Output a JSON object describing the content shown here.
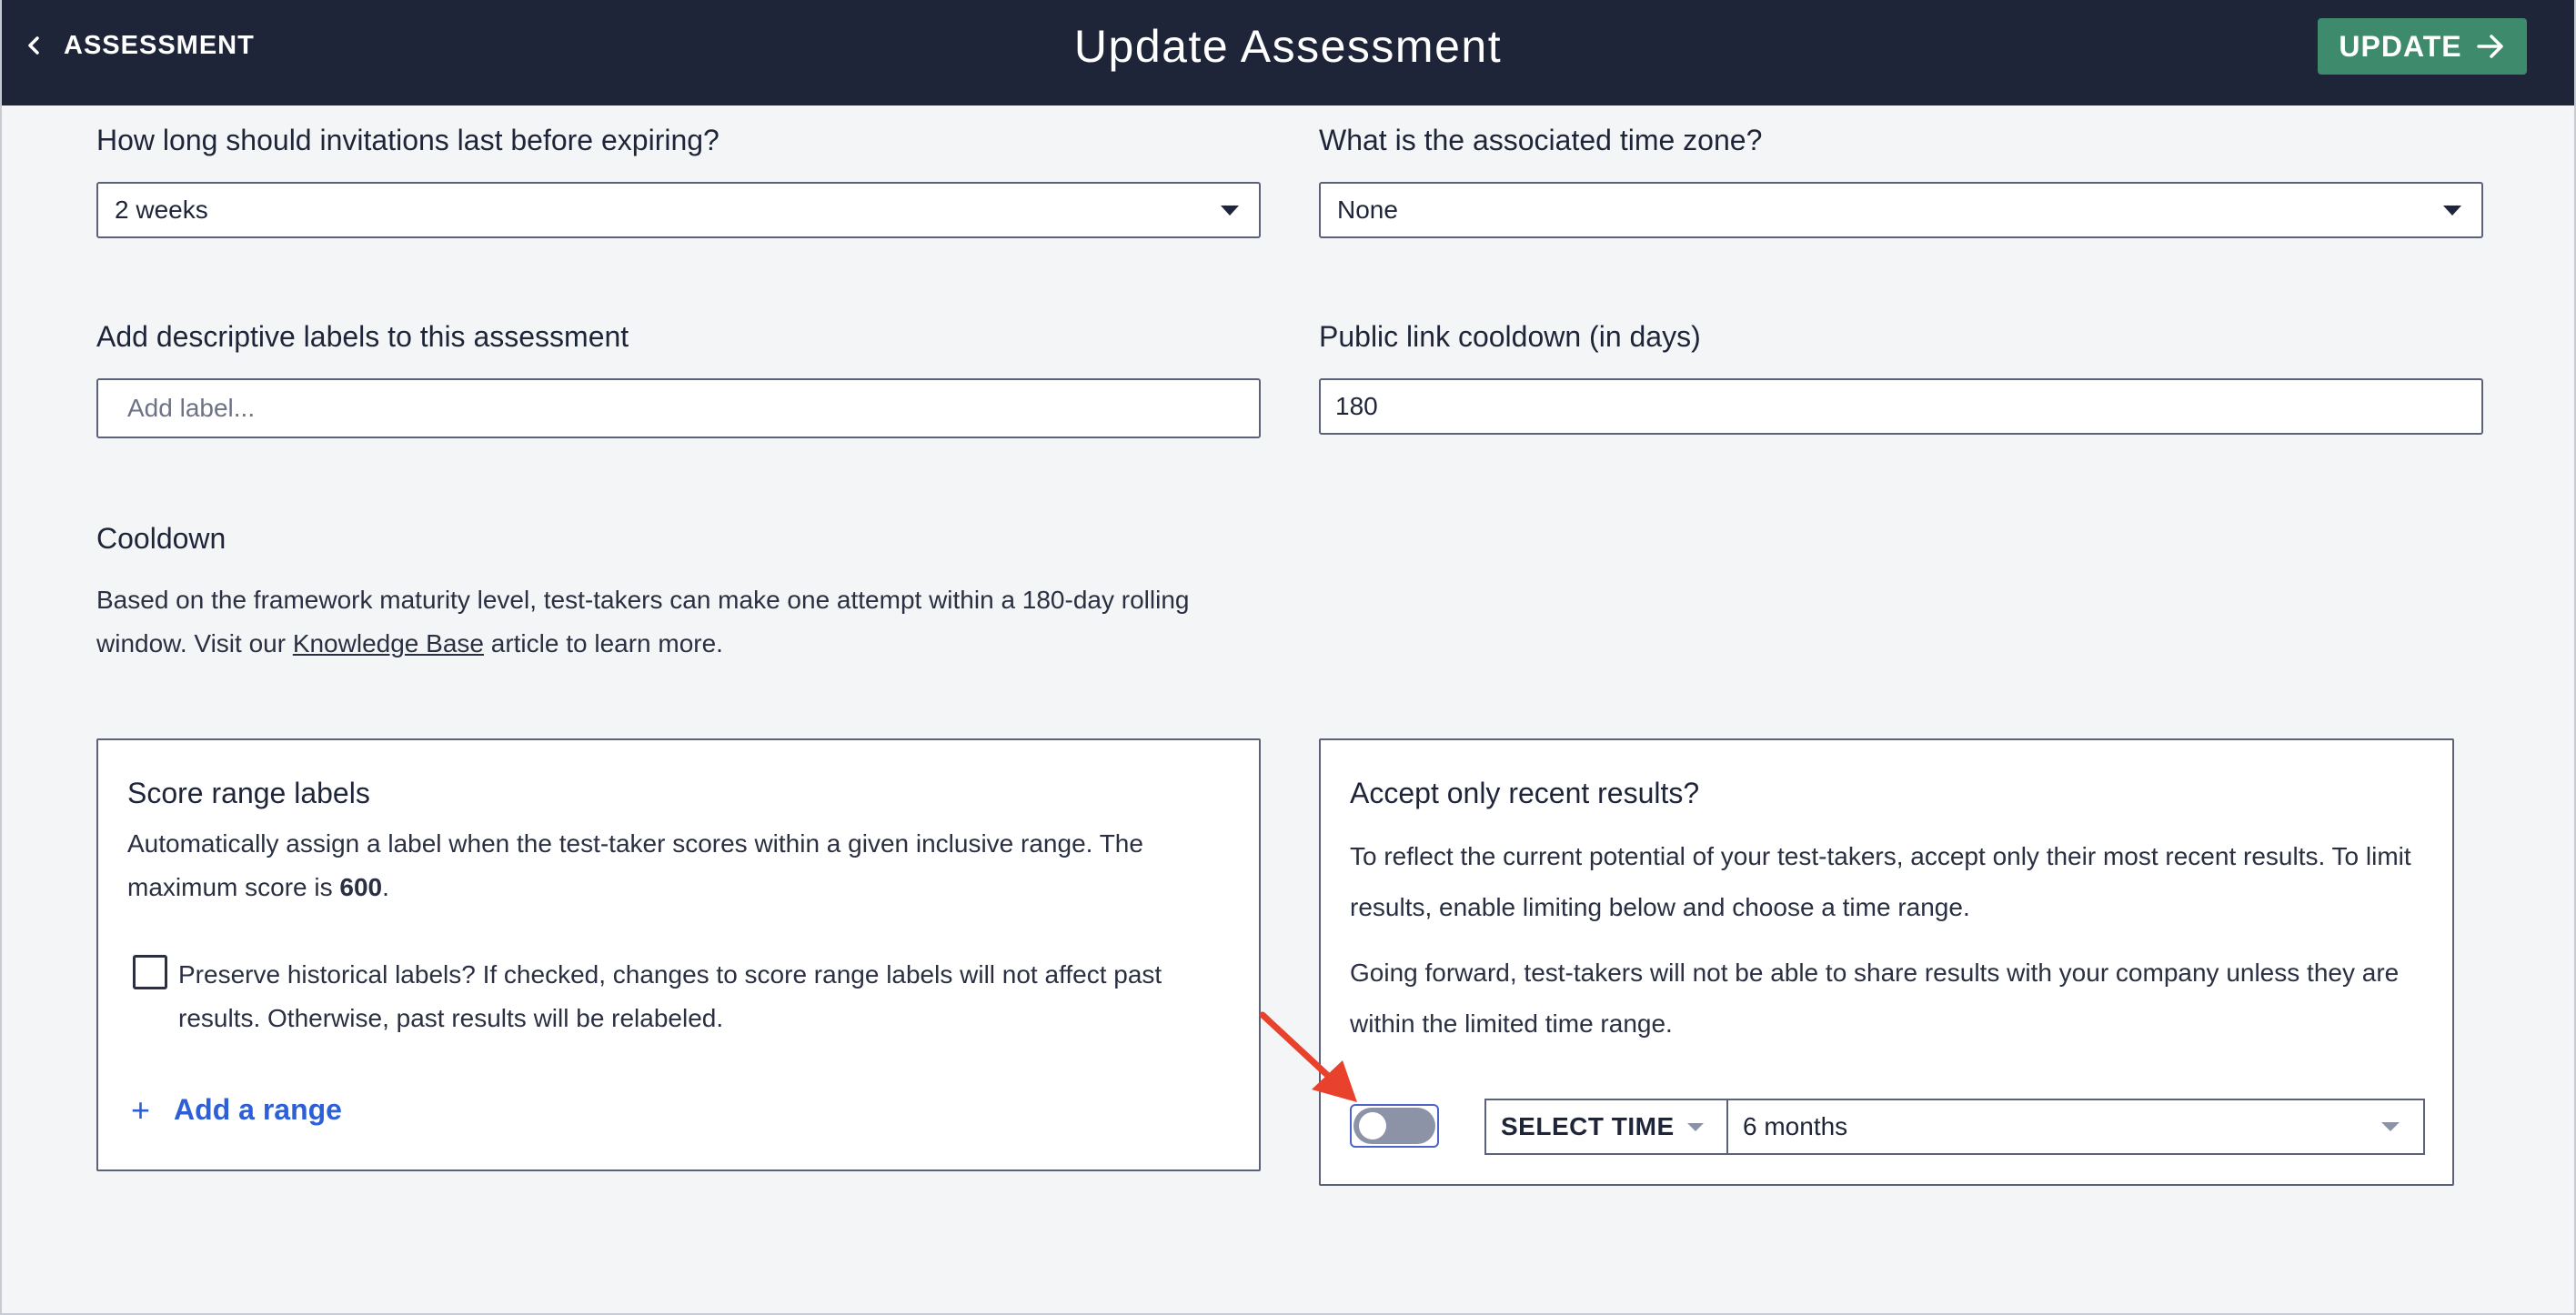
{
  "header": {
    "back_label": "ASSESSMENT",
    "title": "Update Assessment",
    "update_label": "UPDATE",
    "background": "#1f2538",
    "accent": "#3d8a6c"
  },
  "fields": {
    "expiry": {
      "label": "How long should invitations last before expiring?",
      "value": "2 weeks"
    },
    "timezone": {
      "label": "What is the associated time zone?",
      "value": "None"
    },
    "labels": {
      "label": "Add descriptive labels to this assessment",
      "placeholder": "Add label..."
    },
    "cooldown_days": {
      "label": "Public link cooldown (in days)",
      "value": "180"
    }
  },
  "cooldown": {
    "heading": "Cooldown",
    "text_before": "Based on the framework maturity level, test-takers can make one attempt within a 180-day rolling window. Visit our ",
    "link": "Knowledge Base",
    "text_after": " article to learn more."
  },
  "score_card": {
    "title": "Score range labels",
    "text_before": "Automatically assign a label when the test-taker scores within a given inclusive range. The maximum score is ",
    "max_score": "600",
    "text_after": ".",
    "checkbox_label": "Preserve historical labels? If checked, changes to score range labels will not affect past results. Otherwise, past results will be relabeled.",
    "add_range_plus": "+",
    "add_range": "Add a range"
  },
  "recent_card": {
    "title": "Accept only recent results?",
    "p1": "To reflect the current potential of your test-takers, accept only their most recent results. To limit results, enable limiting below and choose a time range.",
    "p2": "Going forward, test-takers will not be able to share results with your company unless they are within the limited time range.",
    "toggle_on": false,
    "select_time_label": "SELECT TIME",
    "time_value": "6 months"
  },
  "icons": {
    "back": "chevron-left-icon",
    "update": "arrow-right-icon",
    "annotation": "red-arrow-icon"
  },
  "colors": {
    "link_blue": "#2d5fd6",
    "annotation_red": "#e8412c"
  }
}
